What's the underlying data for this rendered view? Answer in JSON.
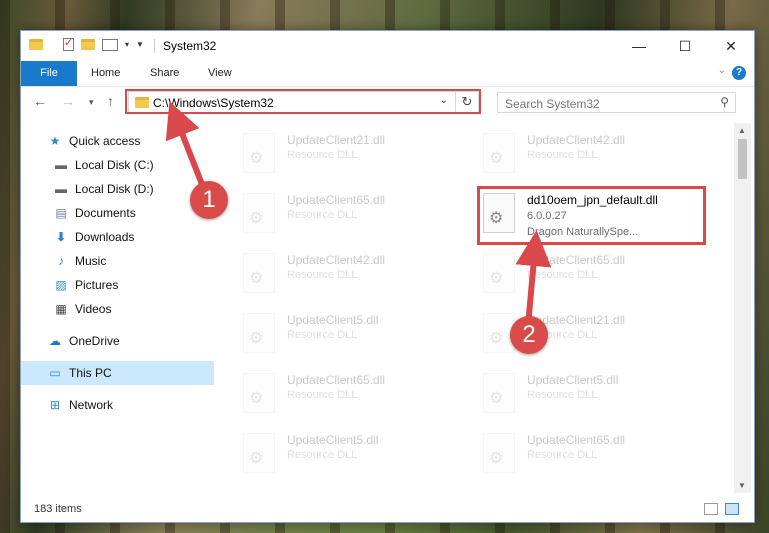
{
  "window": {
    "title": "System32"
  },
  "ribbon": {
    "tabs": [
      "File",
      "Home",
      "Share",
      "View"
    ]
  },
  "navigation": {
    "address": "C:\\Windows\\System32",
    "search_placeholder": "Search System32"
  },
  "sidebar": {
    "items": [
      {
        "label": "Quick access",
        "icon": "star-icon"
      },
      {
        "label": "Local Disk (C:)",
        "icon": "drive-icon"
      },
      {
        "label": "Local Disk (D:)",
        "icon": "drive-icon"
      },
      {
        "label": "Documents",
        "icon": "documents-icon"
      },
      {
        "label": "Downloads",
        "icon": "download-icon"
      },
      {
        "label": "Music",
        "icon": "music-icon"
      },
      {
        "label": "Pictures",
        "icon": "pictures-icon"
      },
      {
        "label": "Videos",
        "icon": "videos-icon"
      },
      {
        "label": "OneDrive",
        "icon": "cloud-icon"
      },
      {
        "label": "This PC",
        "icon": "computer-icon"
      },
      {
        "label": "Network",
        "icon": "network-icon"
      }
    ]
  },
  "files": {
    "left": [
      {
        "name": "UpdateClient21.dll",
        "type": "Resource DLL"
      },
      {
        "name": "UpdateClient65.dll",
        "type": "Resource DLL"
      },
      {
        "name": "UpdateClient42.dll",
        "type": "Resource DLL"
      },
      {
        "name": "UpdateClient5.dll",
        "type": "Resource DLL"
      },
      {
        "name": "UpdateClient65.dll",
        "type": "Resource DLL"
      },
      {
        "name": "UpdateClient5.dll",
        "type": "Resource DLL"
      }
    ],
    "right": [
      {
        "name": "UpdateClient42.dll",
        "type": "Resource DLL"
      },
      {
        "name": "UpdateClient65.dll",
        "type": "Resource DLL"
      },
      {
        "name": "UpdateClient21.dll",
        "type": "Resource DLL"
      },
      {
        "name": "UpdateClient5.dll",
        "type": "Resource DLL"
      },
      {
        "name": "UpdateClient65.dll",
        "type": "Resource DLL"
      }
    ],
    "highlighted": {
      "name": "dd10oem_jpn_default.dll",
      "version": "6.0.0.27",
      "description": "Dragon NaturallySpe..."
    }
  },
  "status": {
    "items_count": "183 items"
  },
  "annotations": {
    "step1": "1",
    "step2": "2"
  },
  "colors": {
    "accent": "#1979ca",
    "highlight": "#d9484a",
    "selection": "#cce8ff"
  }
}
